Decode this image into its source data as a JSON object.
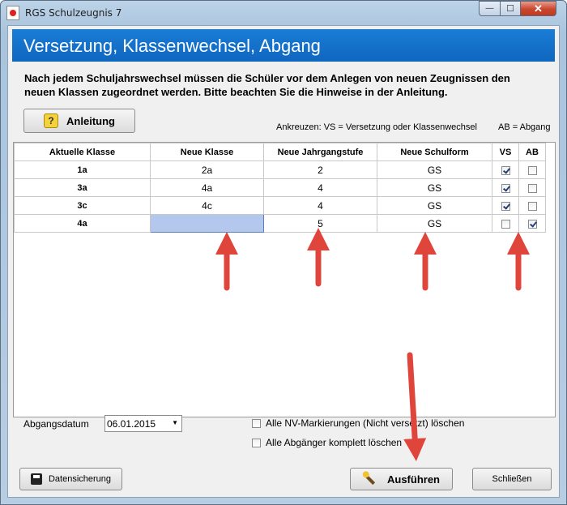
{
  "window": {
    "title": "RGS Schulzeugnis 7",
    "minimize_glyph": "—",
    "maximize_glyph": "☐",
    "close_glyph": "✕"
  },
  "banner": {
    "title": "Versetzung, Klassenwechsel, Abgang"
  },
  "description": {
    "line1": "Nach jedem Schuljahrswechsel müssen die Schüler vor dem Anlegen von neuen Zeugnissen den",
    "line2": "neuen Klassen zugeordnet werden. Bitte beachten Sie die Hinweise in der Anleitung."
  },
  "help_button": {
    "label": "Anleitung",
    "icon": "question-icon",
    "icon_glyph": "?"
  },
  "hints": {
    "vs": "Ankreuzen:  VS = Versetzung oder Klassenwechsel",
    "ab": "AB = Abgang"
  },
  "table": {
    "headers": [
      "Aktuelle Klasse",
      "Neue Klasse",
      "Neue Jahrgangstufe",
      "Neue Schulform",
      "VS",
      "AB"
    ],
    "rows": [
      {
        "current": "1a",
        "new_class": "2a",
        "grade": "2",
        "school_form": "GS",
        "vs": true,
        "ab": false
      },
      {
        "current": "3a",
        "new_class": "4a",
        "grade": "4",
        "school_form": "GS",
        "vs": true,
        "ab": false
      },
      {
        "current": "3c",
        "new_class": "4c",
        "grade": "4",
        "school_form": "GS",
        "vs": true,
        "ab": false
      },
      {
        "current": "4a",
        "new_class": "",
        "grade": "5",
        "school_form": "GS",
        "vs": false,
        "ab": true
      }
    ]
  },
  "departure": {
    "label": "Abgangsdatum",
    "value": "06.01.2015",
    "dropdown_glyph": "▼"
  },
  "options": {
    "nv_label": "Alle NV-Markierungen (Nicht versetzt) löschen",
    "nv_checked": false,
    "leavers_label": "Alle Abgänger komplett löschen",
    "leavers_checked": false
  },
  "footer": {
    "save_label": "Datensicherung",
    "run_label": "Ausführen",
    "close_label": "Schließen"
  },
  "colors": {
    "banner": "#1a7dd6",
    "arrow": "#e0453c",
    "selection": "#b3c8ec"
  }
}
